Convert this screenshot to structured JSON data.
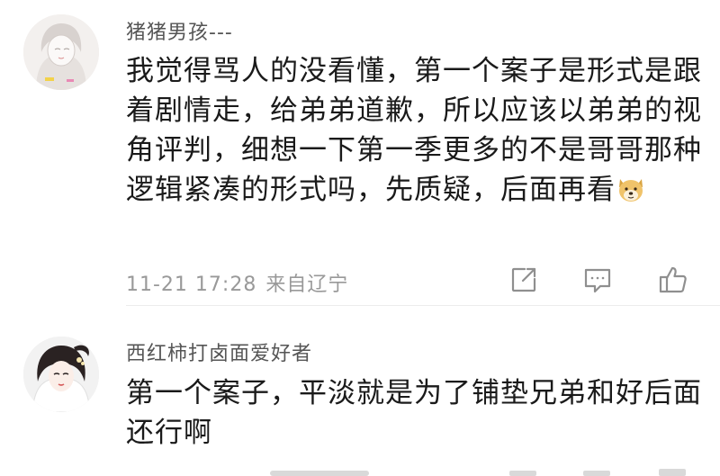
{
  "comments": [
    {
      "username": "猪猪男孩---",
      "text": "我觉得骂人的没看懂，第一个案子是形式是跟着剧情走，给弟弟道歉，所以应该以弟弟的视角评判，细想一下第一季更多的不是哥哥那种逻辑紧凑的形式吗，先质疑，后面再看",
      "emoji": "doge-emoji",
      "time": "11-21 17:28",
      "location": "来自辽宁",
      "actions": [
        "share-icon",
        "reply-icon",
        "like-icon"
      ]
    },
    {
      "username": "西红柿打卤面爱好者",
      "text": "第一个案子，平淡就是为了铺垫兄弟和好后面还行啊"
    }
  ],
  "colors": {
    "username": "#555555",
    "body_text": "#1a1a1a",
    "meta_text": "#999999",
    "icon": "#8f8f8f",
    "divider": "#ececec"
  }
}
